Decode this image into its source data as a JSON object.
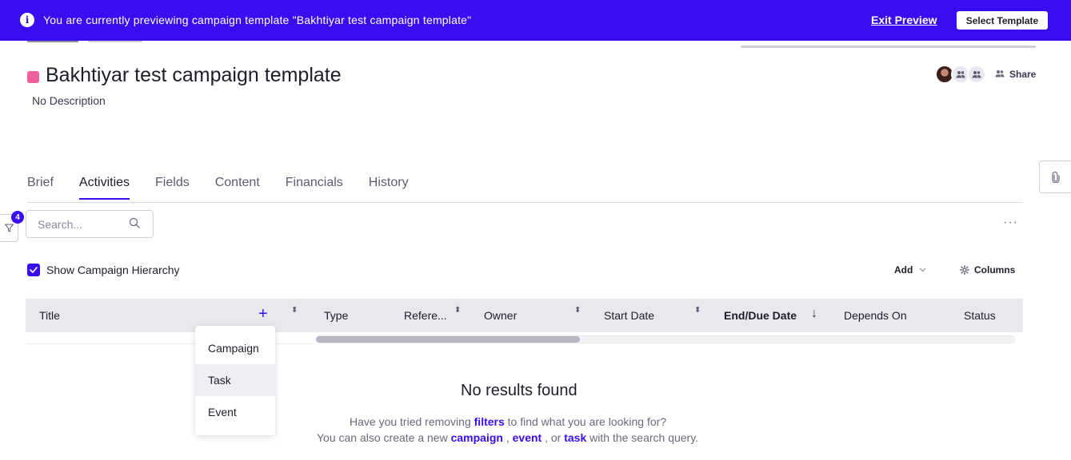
{
  "banner": {
    "message": "You are currently previewing campaign template \"Bakhtiyar test campaign template\"",
    "exit_label": "Exit Preview",
    "select_label": "Select Template",
    "color": "#3a0cf2"
  },
  "header": {
    "title": "Bakhtiyar test campaign template",
    "description": "No Description",
    "swatch_color": "#f0609e",
    "share_label": "Share"
  },
  "tabs": [
    {
      "label": "Brief",
      "active": false
    },
    {
      "label": "Activities",
      "active": true
    },
    {
      "label": "Fields",
      "active": false
    },
    {
      "label": "Content",
      "active": false
    },
    {
      "label": "Financials",
      "active": false
    },
    {
      "label": "History",
      "active": false
    }
  ],
  "filter": {
    "badge_count": "4"
  },
  "search": {
    "placeholder": "Search...",
    "value": ""
  },
  "toolbar": {
    "hierarchy_label": "Show Campaign Hierarchy",
    "hierarchy_checked": true,
    "add_label": "Add",
    "columns_label": "Columns",
    "more_label": "···"
  },
  "table": {
    "columns": [
      "Title",
      "Type",
      "Refere...",
      "Owner",
      "Start Date",
      "End/Due Date",
      "Depends On",
      "Status"
    ]
  },
  "add_menu": {
    "items": [
      "Campaign",
      "Task",
      "Event"
    ],
    "hovered": "Task"
  },
  "empty_state": {
    "title": "No results found",
    "line1_pre": "Have you tried removing ",
    "line1_link": "filters",
    "line1_post": " to find what you are looking for?",
    "line2_pre": "You can also create a new ",
    "link_campaign": "campaign",
    "sep1": " , ",
    "link_event": "event",
    "sep2": " , or ",
    "link_task": "task",
    "line2_post": " with the search query."
  }
}
